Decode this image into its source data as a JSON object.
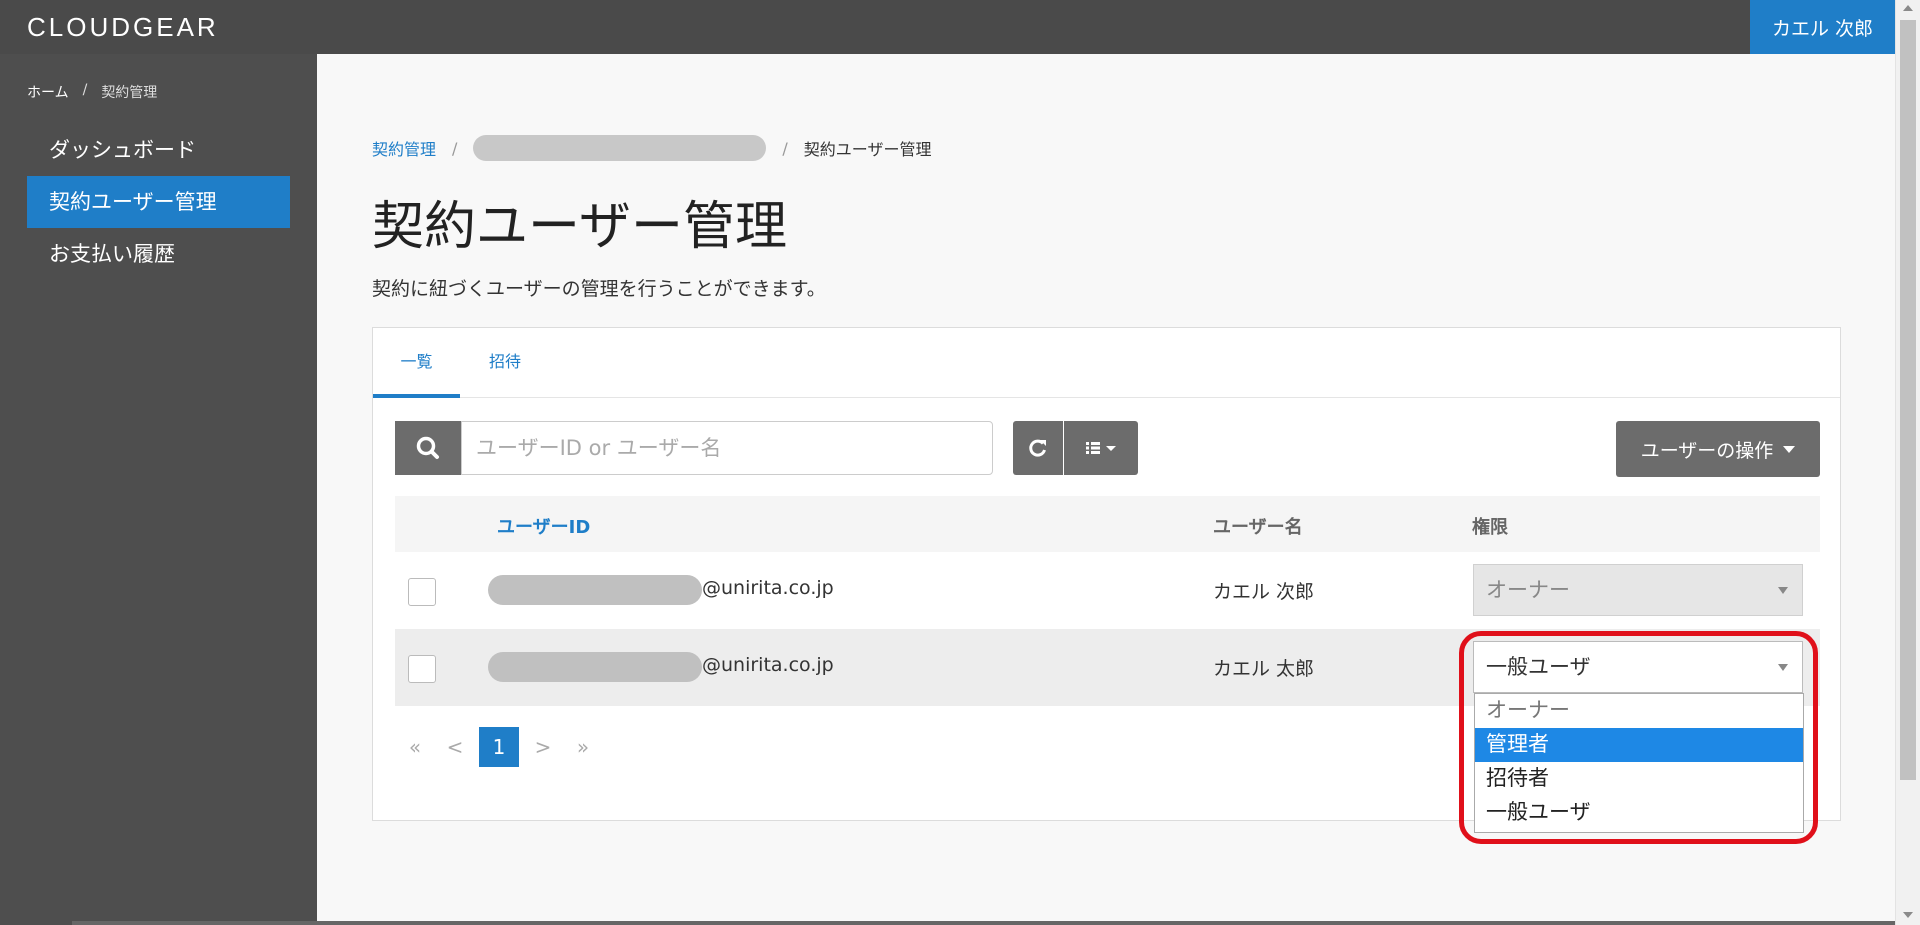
{
  "header": {
    "brand": "CLOUDGEAR",
    "user_name": "カエル 次郎"
  },
  "sidebar": {
    "breadcrumb": {
      "home": "ホーム",
      "separator": "/",
      "current": "契約管理"
    },
    "items": [
      {
        "label": "ダッシュボード",
        "active": false
      },
      {
        "label": "契約ユーザー管理",
        "active": true
      },
      {
        "label": "お支払い履歴",
        "active": false
      }
    ]
  },
  "main": {
    "breadcrumb": {
      "first": "契約管理",
      "separator": "/",
      "current": "契約ユーザー管理"
    },
    "title": "契約ユーザー管理",
    "description": "契約に紐づくユーザーの管理を行うことができます。",
    "tabs": [
      {
        "label": "一覧",
        "active": true
      },
      {
        "label": "招待",
        "active": false
      }
    ],
    "search": {
      "placeholder": "ユーザーID or ユーザー名"
    },
    "user_ops_label": "ユーザーの操作",
    "table": {
      "headers": {
        "id": "ユーザーID",
        "name": "ユーザー名",
        "role": "権限"
      },
      "rows": [
        {
          "domain": "@unirita.co.jp",
          "name": "カエル 次郎",
          "role": "オーナー",
          "disabled": true
        },
        {
          "domain": "@unirita.co.jp",
          "name": "カエル 太郎",
          "role": "一般ユーザ",
          "disabled": false
        }
      ]
    },
    "pagination": {
      "first": "«",
      "prev": "<",
      "current": "1",
      "next": ">",
      "last": "»"
    },
    "role_dropdown": {
      "options": [
        "オーナー",
        "管理者",
        "招待者",
        "一般ユーザ"
      ],
      "highlighted": "管理者"
    }
  },
  "colors": {
    "accent": "#1f7ec8",
    "topbar": "#4a4a4a",
    "sidebar": "#4e4e4e",
    "highlight_ring": "#e0101a"
  }
}
